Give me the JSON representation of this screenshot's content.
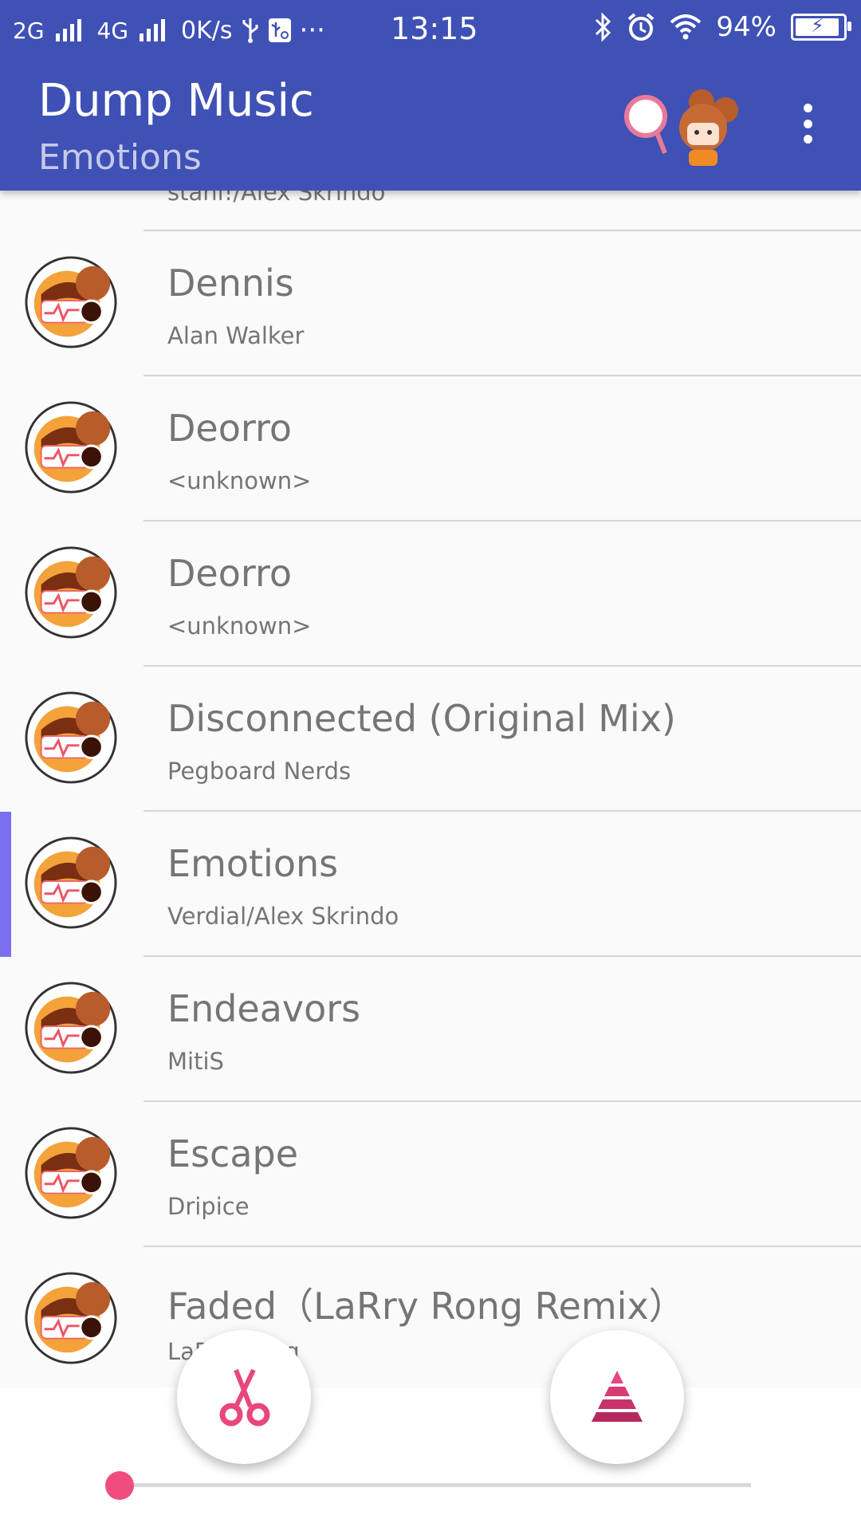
{
  "status_bar": {
    "network_1": "2G",
    "network_2": "4G",
    "speed": "0K/s",
    "more": "···",
    "time": "13:15",
    "battery": "94%"
  },
  "app_bar": {
    "title": "Dump Music",
    "subtitle": "Emotions"
  },
  "songs": [
    {
      "title": "",
      "artist": "stahl!/Alex Skrindo"
    },
    {
      "title": "Dennis",
      "artist": "Alan Walker"
    },
    {
      "title": "Deorro",
      "artist": "<unknown>"
    },
    {
      "title": "Deorro",
      "artist": "<unknown>"
    },
    {
      "title": "Disconnected (Original Mix)",
      "artist": "Pegboard Nerds"
    },
    {
      "title": "Emotions",
      "artist": "Verdial/Alex Skrindo",
      "selected": true
    },
    {
      "title": "Endeavors",
      "artist": "MitiS"
    },
    {
      "title": "Escape",
      "artist": "Dripice"
    },
    {
      "title": "Faded（LaRry Rong Remix）",
      "artist": "LaRry Rong"
    }
  ],
  "player": {
    "progress_fraction": 0.0
  },
  "colors": {
    "primary": "#3f51b5",
    "accent": "#ef4d7d",
    "selection": "#7b6ff0"
  },
  "icons": [
    "usb-icon",
    "usb-debug-icon",
    "bluetooth-icon",
    "alarm-icon",
    "wifi-icon",
    "battery-icon",
    "more-vert-icon",
    "scissors-icon",
    "pyramid-icon"
  ]
}
